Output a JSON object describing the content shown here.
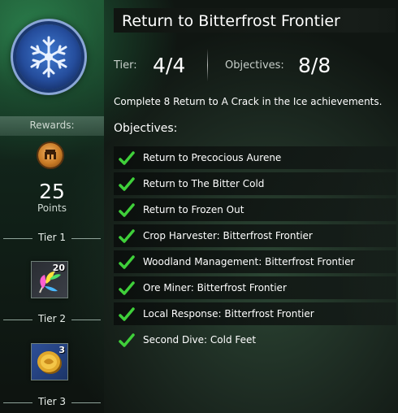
{
  "title": "Return to Bitterfrost Frontier",
  "tier": {
    "label": "Tier:",
    "value": "4/4"
  },
  "objectives_count": {
    "label": "Objectives:",
    "value": "8/8"
  },
  "description": "Complete 8 Return to A Crack in the Ice achievements.",
  "objectives_heading": "Objectives:",
  "objectives": [
    {
      "label": "Return to Precocious Aurene",
      "completed": true
    },
    {
      "label": "Return to The Bitter Cold",
      "completed": true
    },
    {
      "label": "Return to Frozen Out",
      "completed": true
    },
    {
      "label": "Crop Harvester: Bitterfrost Frontier",
      "completed": true
    },
    {
      "label": "Woodland Management: Bitterfrost Frontier",
      "completed": true
    },
    {
      "label": "Ore Miner: Bitterfrost Frontier",
      "completed": true
    },
    {
      "label": "Local Response: Bitterfrost Frontier",
      "completed": true
    },
    {
      "label": "Second Dive: Cold Feet",
      "completed": true
    }
  ],
  "sidebar": {
    "emblem_icon": "snowflake-emblem-icon",
    "rewards_label": "Rewards:",
    "points_icon": "achievement-points-icon",
    "points_value": "25",
    "points_label": "Points",
    "tiers": [
      {
        "label": "Tier 1"
      },
      {
        "label": "Tier 2"
      },
      {
        "label": "Tier 3"
      }
    ],
    "rewards": [
      {
        "icon": "rainbow-feather-icon",
        "count": "20"
      },
      {
        "icon": "gold-coin-icon",
        "count": "3"
      }
    ]
  },
  "colors": {
    "check_green": "#3fd03a",
    "background": "#1d2b22"
  }
}
